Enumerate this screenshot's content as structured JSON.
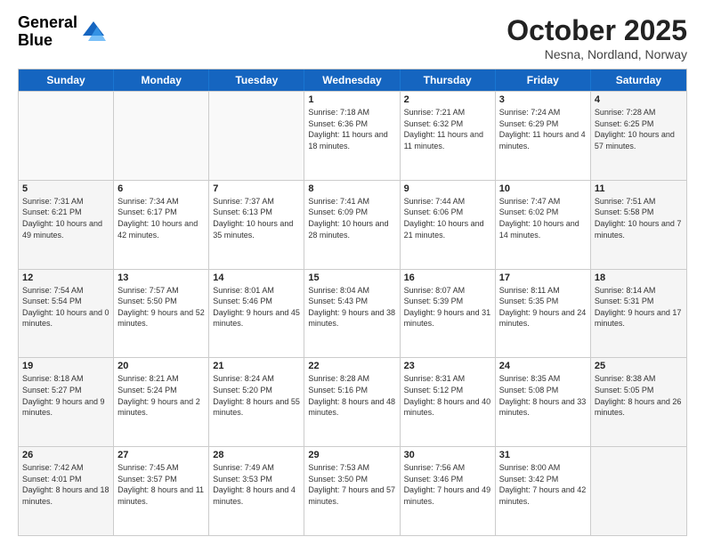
{
  "header": {
    "logo_general": "General",
    "logo_blue": "Blue",
    "month_title": "October 2025",
    "subtitle": "Nesna, Nordland, Norway"
  },
  "weekdays": [
    "Sunday",
    "Monday",
    "Tuesday",
    "Wednesday",
    "Thursday",
    "Friday",
    "Saturday"
  ],
  "rows": [
    [
      {
        "day": "",
        "empty": true
      },
      {
        "day": "",
        "empty": true
      },
      {
        "day": "",
        "empty": true
      },
      {
        "day": "1",
        "sunrise": "7:18 AM",
        "sunset": "6:36 PM",
        "daylight": "11 hours and 18 minutes."
      },
      {
        "day": "2",
        "sunrise": "7:21 AM",
        "sunset": "6:32 PM",
        "daylight": "11 hours and 11 minutes."
      },
      {
        "day": "3",
        "sunrise": "7:24 AM",
        "sunset": "6:29 PM",
        "daylight": "11 hours and 4 minutes."
      },
      {
        "day": "4",
        "sunrise": "7:28 AM",
        "sunset": "6:25 PM",
        "daylight": "10 hours and 57 minutes.",
        "weekend": true
      }
    ],
    [
      {
        "day": "5",
        "sunrise": "7:31 AM",
        "sunset": "6:21 PM",
        "daylight": "10 hours and 49 minutes.",
        "weekend": true
      },
      {
        "day": "6",
        "sunrise": "7:34 AM",
        "sunset": "6:17 PM",
        "daylight": "10 hours and 42 minutes."
      },
      {
        "day": "7",
        "sunrise": "7:37 AM",
        "sunset": "6:13 PM",
        "daylight": "10 hours and 35 minutes."
      },
      {
        "day": "8",
        "sunrise": "7:41 AM",
        "sunset": "6:09 PM",
        "daylight": "10 hours and 28 minutes."
      },
      {
        "day": "9",
        "sunrise": "7:44 AM",
        "sunset": "6:06 PM",
        "daylight": "10 hours and 21 minutes."
      },
      {
        "day": "10",
        "sunrise": "7:47 AM",
        "sunset": "6:02 PM",
        "daylight": "10 hours and 14 minutes."
      },
      {
        "day": "11",
        "sunrise": "7:51 AM",
        "sunset": "5:58 PM",
        "daylight": "10 hours and 7 minutes.",
        "weekend": true
      }
    ],
    [
      {
        "day": "12",
        "sunrise": "7:54 AM",
        "sunset": "5:54 PM",
        "daylight": "10 hours and 0 minutes.",
        "weekend": true
      },
      {
        "day": "13",
        "sunrise": "7:57 AM",
        "sunset": "5:50 PM",
        "daylight": "9 hours and 52 minutes."
      },
      {
        "day": "14",
        "sunrise": "8:01 AM",
        "sunset": "5:46 PM",
        "daylight": "9 hours and 45 minutes."
      },
      {
        "day": "15",
        "sunrise": "8:04 AM",
        "sunset": "5:43 PM",
        "daylight": "9 hours and 38 minutes."
      },
      {
        "day": "16",
        "sunrise": "8:07 AM",
        "sunset": "5:39 PM",
        "daylight": "9 hours and 31 minutes."
      },
      {
        "day": "17",
        "sunrise": "8:11 AM",
        "sunset": "5:35 PM",
        "daylight": "9 hours and 24 minutes."
      },
      {
        "day": "18",
        "sunrise": "8:14 AM",
        "sunset": "5:31 PM",
        "daylight": "9 hours and 17 minutes.",
        "weekend": true
      }
    ],
    [
      {
        "day": "19",
        "sunrise": "8:18 AM",
        "sunset": "5:27 PM",
        "daylight": "9 hours and 9 minutes.",
        "weekend": true
      },
      {
        "day": "20",
        "sunrise": "8:21 AM",
        "sunset": "5:24 PM",
        "daylight": "9 hours and 2 minutes."
      },
      {
        "day": "21",
        "sunrise": "8:24 AM",
        "sunset": "5:20 PM",
        "daylight": "8 hours and 55 minutes."
      },
      {
        "day": "22",
        "sunrise": "8:28 AM",
        "sunset": "5:16 PM",
        "daylight": "8 hours and 48 minutes."
      },
      {
        "day": "23",
        "sunrise": "8:31 AM",
        "sunset": "5:12 PM",
        "daylight": "8 hours and 40 minutes."
      },
      {
        "day": "24",
        "sunrise": "8:35 AM",
        "sunset": "5:08 PM",
        "daylight": "8 hours and 33 minutes."
      },
      {
        "day": "25",
        "sunrise": "8:38 AM",
        "sunset": "5:05 PM",
        "daylight": "8 hours and 26 minutes.",
        "weekend": true
      }
    ],
    [
      {
        "day": "26",
        "sunrise": "7:42 AM",
        "sunset": "4:01 PM",
        "daylight": "8 hours and 18 minutes.",
        "weekend": true
      },
      {
        "day": "27",
        "sunrise": "7:45 AM",
        "sunset": "3:57 PM",
        "daylight": "8 hours and 11 minutes."
      },
      {
        "day": "28",
        "sunrise": "7:49 AM",
        "sunset": "3:53 PM",
        "daylight": "8 hours and 4 minutes."
      },
      {
        "day": "29",
        "sunrise": "7:53 AM",
        "sunset": "3:50 PM",
        "daylight": "7 hours and 57 minutes."
      },
      {
        "day": "30",
        "sunrise": "7:56 AM",
        "sunset": "3:46 PM",
        "daylight": "7 hours and 49 minutes."
      },
      {
        "day": "31",
        "sunrise": "8:00 AM",
        "sunset": "3:42 PM",
        "daylight": "7 hours and 42 minutes."
      },
      {
        "day": "",
        "empty": true,
        "weekend": true
      }
    ]
  ]
}
